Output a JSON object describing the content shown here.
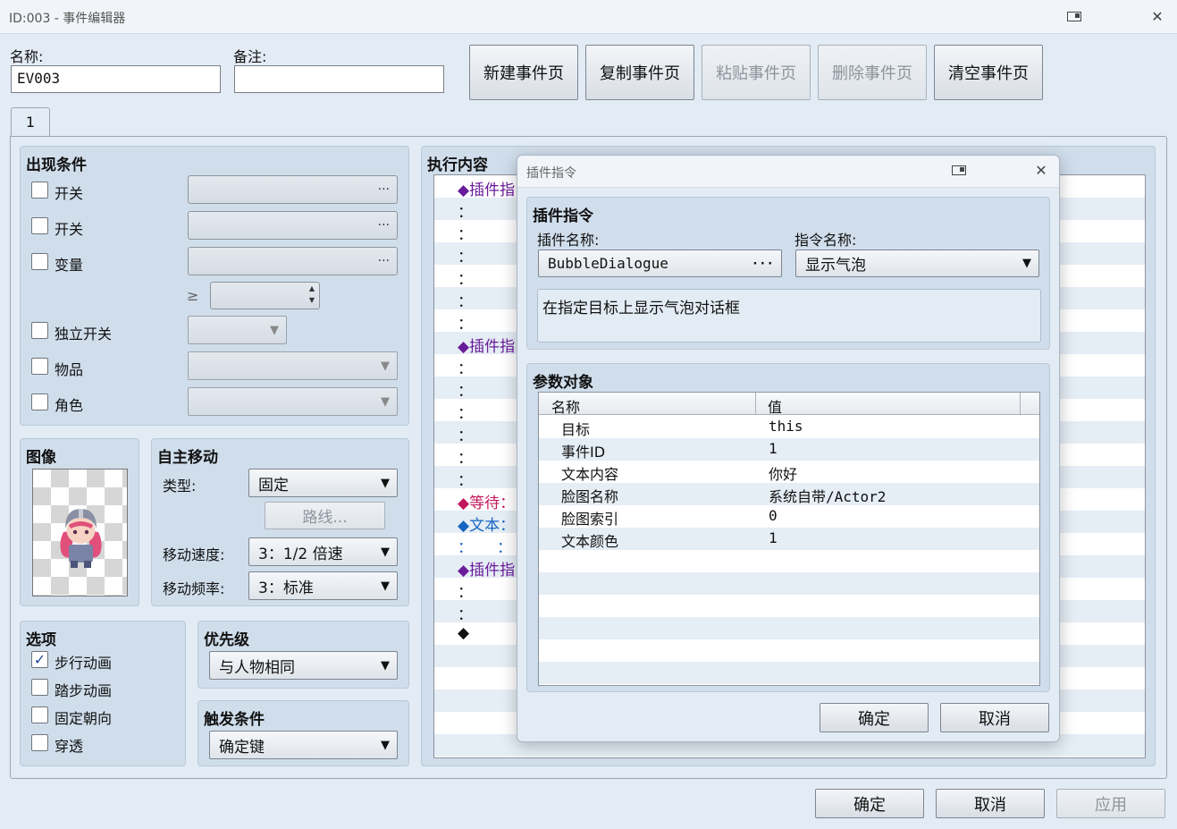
{
  "window": {
    "title": "ID:003 - 事件编辑器"
  },
  "header": {
    "name_label": "名称:",
    "name_value": "EV003",
    "note_label": "备注:",
    "note_value": "",
    "buttons": [
      "新建事件页",
      "复制事件页",
      "粘贴事件页",
      "删除事件页",
      "清空事件页"
    ]
  },
  "tabs": [
    "1"
  ],
  "conditions": {
    "title": "出现条件",
    "switch1": "开关",
    "switch2": "开关",
    "variable": "变量",
    "gte": "≥",
    "self_switch": "独立开关",
    "item": "物品",
    "actor": "角色",
    "ellipsis": "···"
  },
  "image": {
    "title": "图像"
  },
  "autonomous": {
    "title": "自主移动",
    "type_label": "类型:",
    "type_value": "固定",
    "route_button": "路线...",
    "speed_label": "移动速度:",
    "speed_value": "3：1/2 倍速",
    "freq_label": "移动频率:",
    "freq_value": "3：标准"
  },
  "options": {
    "title": "选项",
    "walk": "步行动画",
    "step": "踏步动画",
    "fixed": "固定朝向",
    "through": "穿透",
    "checked": "✓"
  },
  "priority": {
    "title": "优先级",
    "value": "与人物相同"
  },
  "trigger": {
    "title": "触发条件",
    "value": "确定键"
  },
  "contents": {
    "title": "执行内容",
    "rows": [
      {
        "text": "◆插件指",
        "color": "#6a1b9a"
      },
      {
        "text": "：",
        "color": "#111"
      },
      {
        "text": "：",
        "color": "#111"
      },
      {
        "text": "：",
        "color": "#111"
      },
      {
        "text": "：",
        "color": "#111"
      },
      {
        "text": "：",
        "color": "#111"
      },
      {
        "text": "：",
        "color": "#111"
      },
      {
        "text": "◆插件指",
        "color": "#6a1b9a"
      },
      {
        "text": "：",
        "color": "#111"
      },
      {
        "text": "：",
        "color": "#111"
      },
      {
        "text": "：",
        "color": "#111"
      },
      {
        "text": "：",
        "color": "#111"
      },
      {
        "text": "：",
        "color": "#111"
      },
      {
        "text": "：",
        "color": "#111"
      },
      {
        "text": "◆等待：",
        "color": "#c2185b"
      },
      {
        "text": "◆文本：",
        "color": "#1565c0"
      },
      {
        "text": "：     ：",
        "color": "#1565c0"
      },
      {
        "text": "◆插件指",
        "color": "#6a1b9a"
      },
      {
        "text": "：",
        "color": "#111"
      },
      {
        "text": "：",
        "color": "#111"
      },
      {
        "text": "◆",
        "color": "#111"
      }
    ]
  },
  "dialog": {
    "title": "插件指令",
    "section_title": "插件指令",
    "plugin_label": "插件名称:",
    "plugin_value": "BubbleDialogue",
    "plugin_more": "···",
    "command_label": "指令名称:",
    "command_value": "显示气泡",
    "description": "在指定目标上显示气泡对话框",
    "params_title": "参数对象",
    "col_name": "名称",
    "col_value": "值",
    "params": [
      {
        "name": "目标",
        "value": "this"
      },
      {
        "name": "事件ID",
        "value": "1"
      },
      {
        "name": "文本内容",
        "value": "你好"
      },
      {
        "name": "脸图名称",
        "value": "系统自带/Actor2"
      },
      {
        "name": "脸图索引",
        "value": "0"
      },
      {
        "name": "文本颜色",
        "value": "1"
      }
    ],
    "ok": "确定",
    "cancel": "取消"
  },
  "footer": {
    "ok": "确定",
    "cancel": "取消",
    "apply": "应用"
  },
  "icons": {
    "close": "✕",
    "arrow": "▼",
    "up": "▲",
    "down": "▼"
  }
}
